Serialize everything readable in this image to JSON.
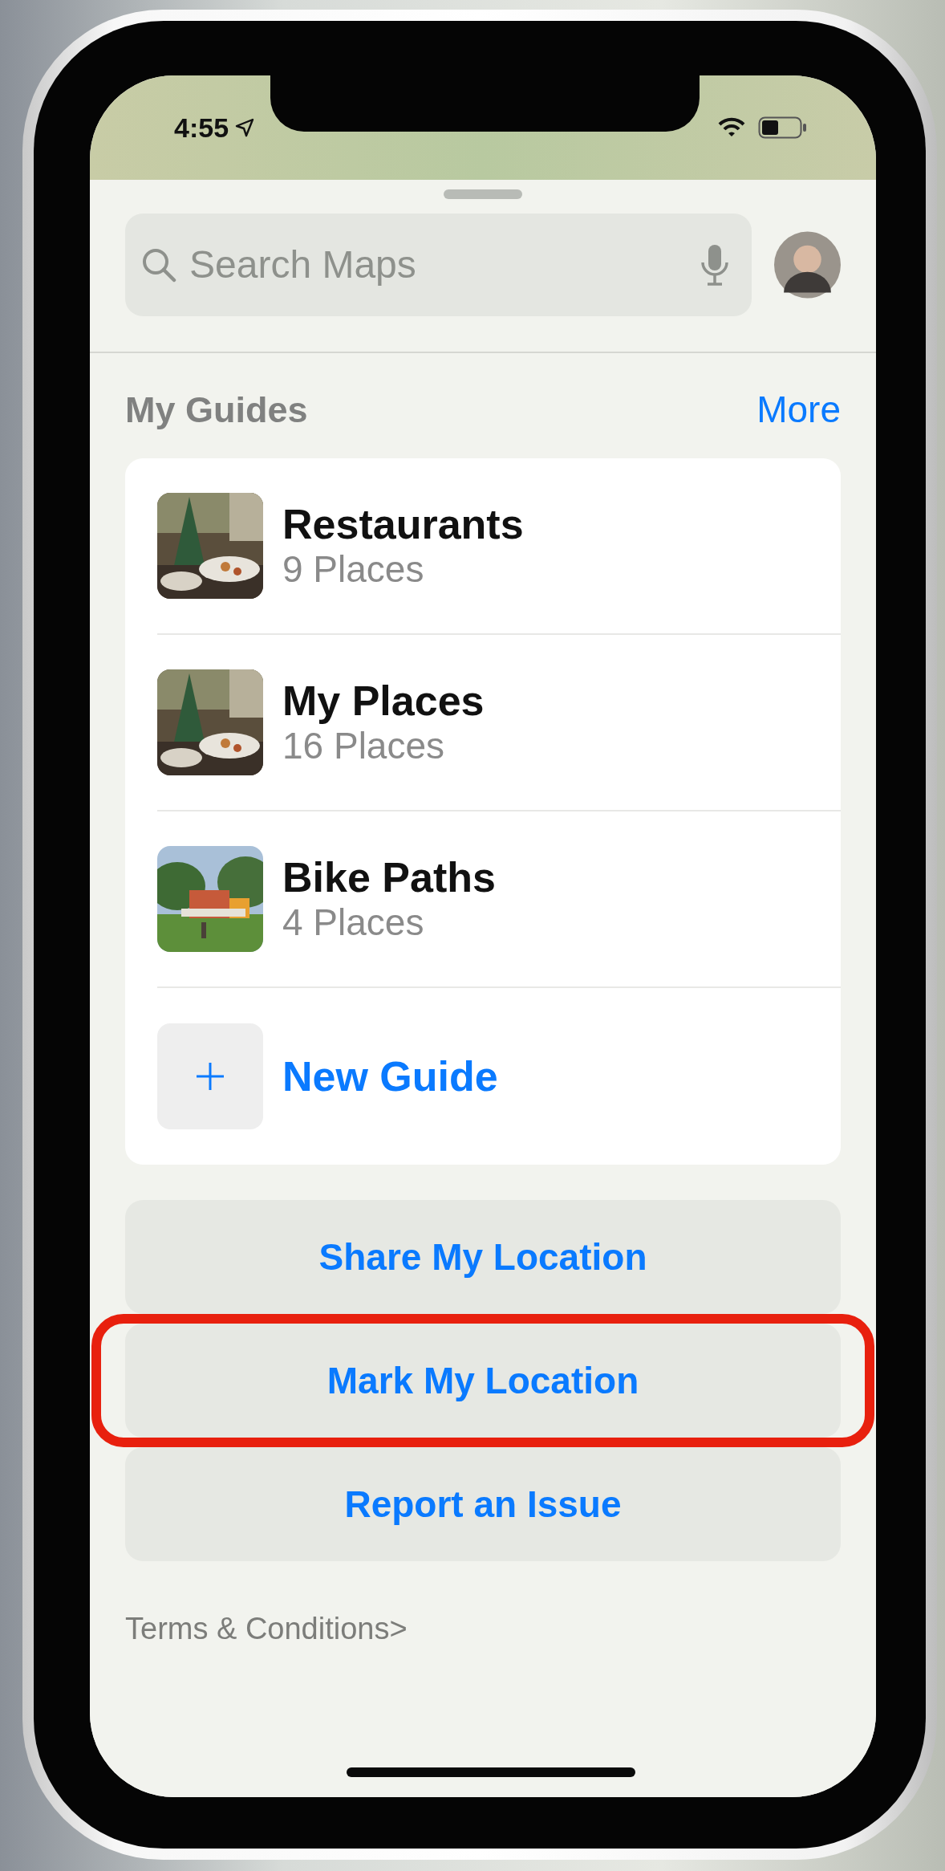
{
  "status_bar": {
    "time": "4:55"
  },
  "search": {
    "placeholder": "Search Maps"
  },
  "guides": {
    "title": "My Guides",
    "more": "More",
    "items": [
      {
        "title": "Restaurants",
        "subtitle": "9 Places",
        "kind": "indoor"
      },
      {
        "title": "My Places",
        "subtitle": "16 Places",
        "kind": "indoor"
      },
      {
        "title": "Bike Paths",
        "subtitle": "4 Places",
        "kind": "park"
      }
    ],
    "new_guide": "New Guide"
  },
  "actions": [
    {
      "label": "Share My Location",
      "highlighted": false
    },
    {
      "label": "Mark My Location",
      "highlighted": true
    },
    {
      "label": "Report an Issue",
      "highlighted": false
    }
  ],
  "terms": "Terms & Conditions>"
}
